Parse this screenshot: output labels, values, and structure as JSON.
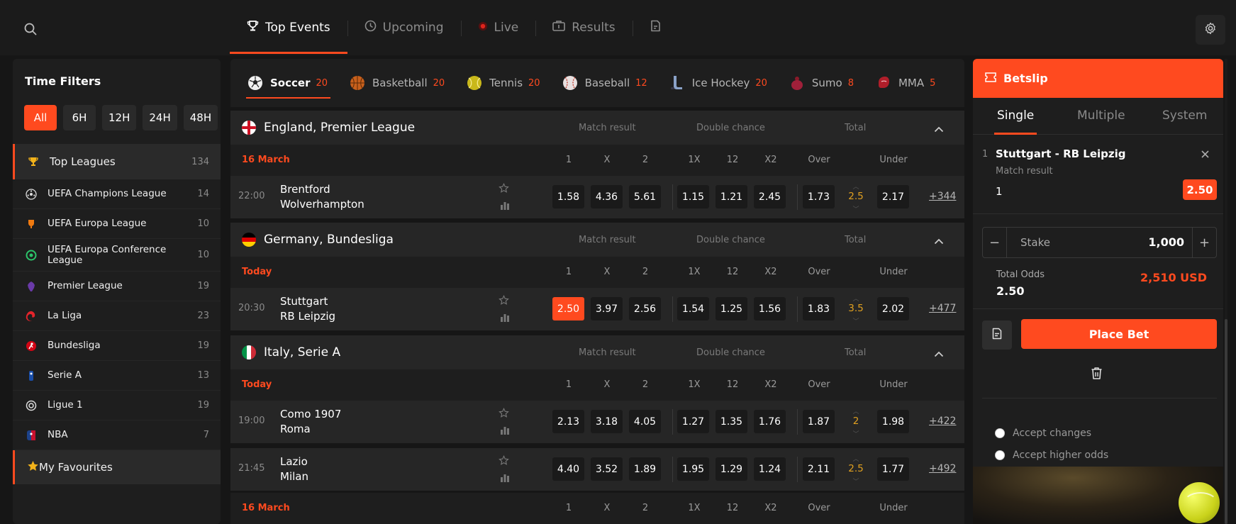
{
  "nav": {
    "items": [
      {
        "label": "Top Events",
        "icon": "trophy-icon",
        "active": true
      },
      {
        "label": "Upcoming",
        "icon": "clock-icon",
        "active": false
      },
      {
        "label": "Live",
        "icon": "live-dot-icon",
        "active": false
      },
      {
        "label": "Results",
        "icon": "results-icon",
        "active": false
      }
    ]
  },
  "sidebar": {
    "title": "Time Filters",
    "time_filters": [
      "All",
      "6H",
      "12H",
      "24H",
      "48H"
    ],
    "active_filter": "All",
    "top_leagues": {
      "label": "Top Leagues",
      "count": "134"
    },
    "leagues": [
      {
        "name": "UEFA Champions League",
        "count": "14"
      },
      {
        "name": "UEFA Europa League",
        "count": "10"
      },
      {
        "name": "UEFA Europa Conference League",
        "count": "10"
      },
      {
        "name": "Premier League",
        "count": "19"
      },
      {
        "name": "La Liga",
        "count": "23"
      },
      {
        "name": "Bundesliga",
        "count": "19"
      },
      {
        "name": "Serie A",
        "count": "13"
      },
      {
        "name": "Ligue 1",
        "count": "19"
      },
      {
        "name": "NBA",
        "count": "7"
      }
    ],
    "favourites": "My Favourites"
  },
  "sports": [
    {
      "name": "Soccer",
      "count": "20",
      "active": true
    },
    {
      "name": "Basketball",
      "count": "20"
    },
    {
      "name": "Tennis",
      "count": "20"
    },
    {
      "name": "Baseball",
      "count": "12"
    },
    {
      "name": "Ice Hockey",
      "count": "20"
    },
    {
      "name": "Sumo",
      "count": "8"
    },
    {
      "name": "MMA",
      "count": "5"
    }
  ],
  "markets": {
    "match_result": "Match result",
    "double_chance": "Double chance",
    "total": "Total"
  },
  "columns": {
    "c1": "1",
    "cx": "X",
    "c2": "2",
    "d1x": "1X",
    "d12": "12",
    "dx2": "X2",
    "over": "Over",
    "under": "Under"
  },
  "competitions": [
    {
      "name": "England, Premier League",
      "date": "16 March",
      "matches": [
        {
          "time": "22:00",
          "home": "Brentford",
          "away": "Wolverhampton",
          "odds": [
            "1.58",
            "4.36",
            "5.61",
            "1.15",
            "1.21",
            "2.45",
            "1.73",
            "2.17"
          ],
          "total": "2.5",
          "more": "+344"
        }
      ]
    },
    {
      "name": "Germany, Bundesliga",
      "date": "Today",
      "matches": [
        {
          "time": "20:30",
          "home": "Stuttgart",
          "away": "RB Leipzig",
          "odds": [
            "2.50",
            "3.97",
            "2.56",
            "1.54",
            "1.25",
            "1.56",
            "1.83",
            "2.02"
          ],
          "total": "3.5",
          "more": "+477"
        }
      ]
    },
    {
      "name": "Italy, Serie A",
      "date": "Today",
      "matches": [
        {
          "time": "19:00",
          "home": "Como 1907",
          "away": "Roma",
          "odds": [
            "2.13",
            "3.18",
            "4.05",
            "1.27",
            "1.35",
            "1.76",
            "1.87",
            "1.98"
          ],
          "total": "2",
          "more": "+422"
        },
        {
          "time": "21:45",
          "home": "Lazio",
          "away": "Milan",
          "odds": [
            "4.40",
            "3.52",
            "1.89",
            "1.95",
            "1.29",
            "1.24",
            "2.11",
            "1.77"
          ],
          "total": "2.5",
          "more": "+492"
        }
      ],
      "next_date": "16 March"
    }
  ],
  "betslip": {
    "title": "Betslip",
    "tabs": [
      "Single",
      "Multiple",
      "System"
    ],
    "selection": {
      "index": "1",
      "match": "Stuttgart - RB Leipzig",
      "market": "Match result",
      "pick": "1",
      "odd": "2.50"
    },
    "stake_label": "Stake",
    "stake_value": "1,000",
    "total_odds_label": "Total Odds",
    "total_odds_value": "2.50",
    "payout": "2,510 USD",
    "place_bet": "Place Bet",
    "options": [
      "Accept changes",
      "Accept higher odds"
    ]
  },
  "colors": {
    "accent": "#ff4a1f",
    "odds_total": "#e0a020",
    "background": "#161616",
    "panel": "#1e1e1e"
  }
}
